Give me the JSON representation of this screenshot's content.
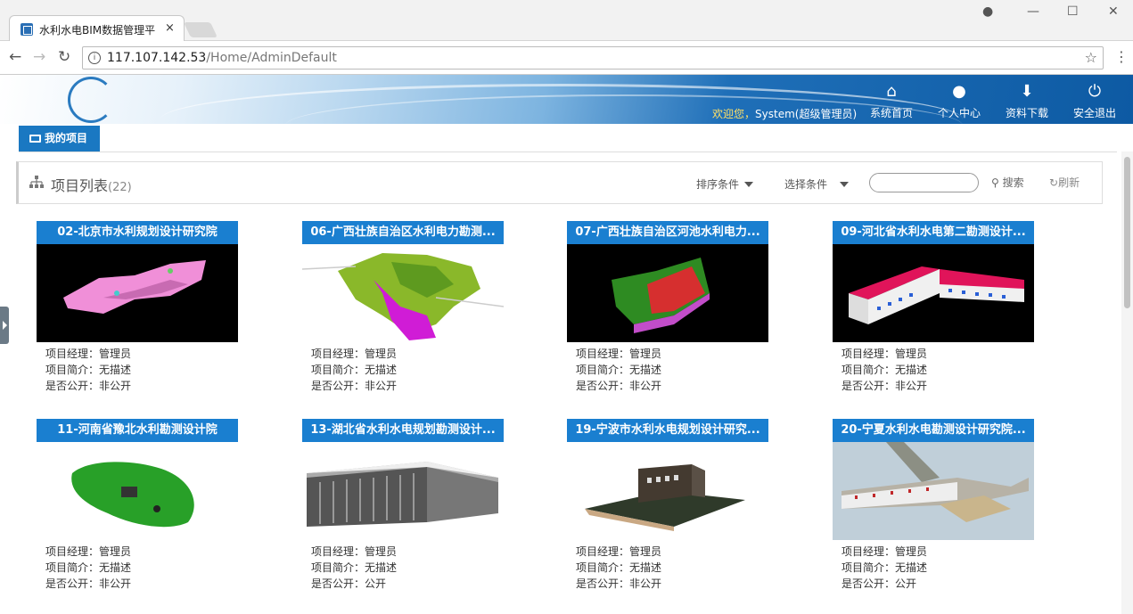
{
  "browser": {
    "tab_title": "水利水电BIM数据管理平",
    "tab_close": "×",
    "url_host": "117.107.142.53",
    "url_path": "/Home/AdminDefault",
    "back": "←",
    "forward": "→",
    "reload": "↻",
    "info": "i",
    "star": "☆",
    "menu": "⋮",
    "account_icon": "●",
    "minimize": "—",
    "maximize": "☐",
    "close": "✕"
  },
  "header": {
    "welcome_prefix": "欢迎您，",
    "welcome_user": "System(超级管理员)",
    "nav": [
      {
        "label": "系统首页",
        "icon": "home-icon",
        "glyph": "⌂"
      },
      {
        "label": "个人中心",
        "icon": "user-icon",
        "glyph": "●"
      },
      {
        "label": "资料下载",
        "icon": "download-icon",
        "glyph": "⬇"
      },
      {
        "label": "安全退出",
        "icon": "power-icon",
        "glyph": "⏻"
      }
    ]
  },
  "tabs": {
    "my_projects": "我的项目"
  },
  "panel": {
    "title": "项目列表",
    "count": "(22)",
    "sort": "排序条件",
    "filter": "选择条件",
    "search": "搜索",
    "refresh": "刷新",
    "search_glyph": "⚲",
    "refresh_glyph": "↻"
  },
  "labels": {
    "manager": "项目经理：",
    "desc": "项目简介：",
    "public": "是否公开："
  },
  "projects": [
    {
      "title": "02-北京市水利规划设计研究院",
      "manager": "管理员",
      "desc": "无描述",
      "public": "非公开"
    },
    {
      "title": "06-广西壮族自治区水利电力勘测...",
      "manager": "管理员",
      "desc": "无描述",
      "public": "非公开"
    },
    {
      "title": "07-广西壮族自治区河池水利电力...",
      "manager": "管理员",
      "desc": "无描述",
      "public": "非公开"
    },
    {
      "title": "09-河北省水利水电第二勘测设计...",
      "manager": "管理员",
      "desc": "无描述",
      "public": "非公开"
    },
    {
      "title": "11-河南省豫北水利勘测设计院",
      "manager": "管理员",
      "desc": "无描述",
      "public": "非公开"
    },
    {
      "title": "13-湖北省水利水电规划勘测设计...",
      "manager": "管理员",
      "desc": "无描述",
      "public": "公开"
    },
    {
      "title": "19-宁波市水利水电规划设计研究...",
      "manager": "管理员",
      "desc": "无描述",
      "public": "非公开"
    },
    {
      "title": "20-宁夏水利水电勘测设计研究院...",
      "manager": "管理员",
      "desc": "无描述",
      "public": "公开"
    }
  ],
  "colors": {
    "primary": "#1a7fd0",
    "tab": "#1a78c2",
    "welcome_highlight": "#ffe066"
  }
}
